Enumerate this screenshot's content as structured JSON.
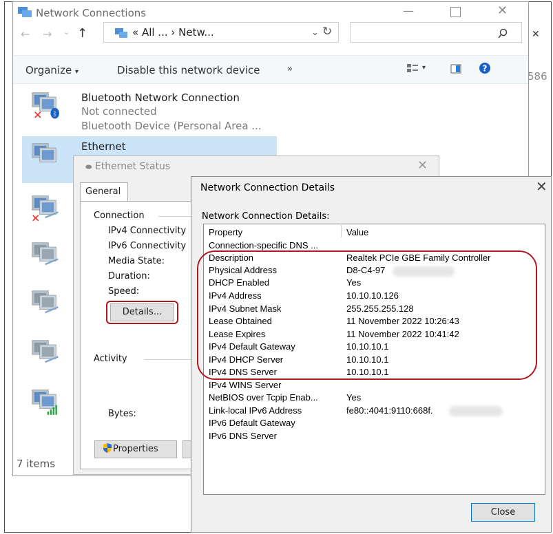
{
  "explorer": {
    "title": "Network Connections",
    "address": "« All ... › Netw...",
    "toolbar": {
      "organize": "Organize",
      "disable": "Disable this network device",
      "more": "»"
    },
    "behind_text": "586",
    "connections": [
      {
        "name": "Bluetooth Network Connection",
        "status": "Not connected",
        "device": "Bluetooth Device (Personal Area ..."
      },
      {
        "name": "Ethernet"
      }
    ],
    "status_count": "7 items"
  },
  "ethernet_status": {
    "title": "Ethernet Status",
    "tab": "General",
    "section_connection": "Connection",
    "fields": [
      "IPv4 Connectivity",
      "IPv6 Connectivity",
      "Media State:",
      "Duration:",
      "Speed:"
    ],
    "details_button": "Details...",
    "section_activity": "Activity",
    "bytes_label": "Bytes:",
    "properties_button": "Properties"
  },
  "details": {
    "title": "Network Connection Details",
    "caption": "Network Connection Details:",
    "col_property": "Property",
    "col_value": "Value",
    "rows": [
      {
        "p": "Connection-specific DNS ...",
        "v": ""
      },
      {
        "p": "Description",
        "v": "Realtek PCIe GBE Family Controller"
      },
      {
        "p": "Physical Address",
        "v": "D8-C4-97"
      },
      {
        "p": "DHCP Enabled",
        "v": "Yes"
      },
      {
        "p": "IPv4 Address",
        "v": "10.10.10.126"
      },
      {
        "p": "IPv4 Subnet Mask",
        "v": "255.255.255.128"
      },
      {
        "p": "Lease Obtained",
        "v": "11 November 2022 10:26:43"
      },
      {
        "p": "Lease Expires",
        "v": "11 November 2022 10:41:42"
      },
      {
        "p": "IPv4 Default Gateway",
        "v": "10.10.10.1"
      },
      {
        "p": "IPv4 DHCP Server",
        "v": "10.10.10.1"
      },
      {
        "p": "IPv4 DNS Server",
        "v": "10.10.10.1"
      },
      {
        "p": "IPv4 WINS Server",
        "v": ""
      },
      {
        "p": "NetBIOS over Tcpip Enab...",
        "v": "Yes"
      },
      {
        "p": "Link-local IPv6 Address",
        "v": "fe80::4041:9110:668f."
      },
      {
        "p": "IPv6 Default Gateway",
        "v": ""
      },
      {
        "p": "IPv6 DNS Server",
        "v": ""
      }
    ],
    "close_button": "Close"
  },
  "colors": {
    "annotation_red": "#b0181e",
    "selection_blue": "#cce4f7",
    "help_blue": "#1a5fc9"
  }
}
